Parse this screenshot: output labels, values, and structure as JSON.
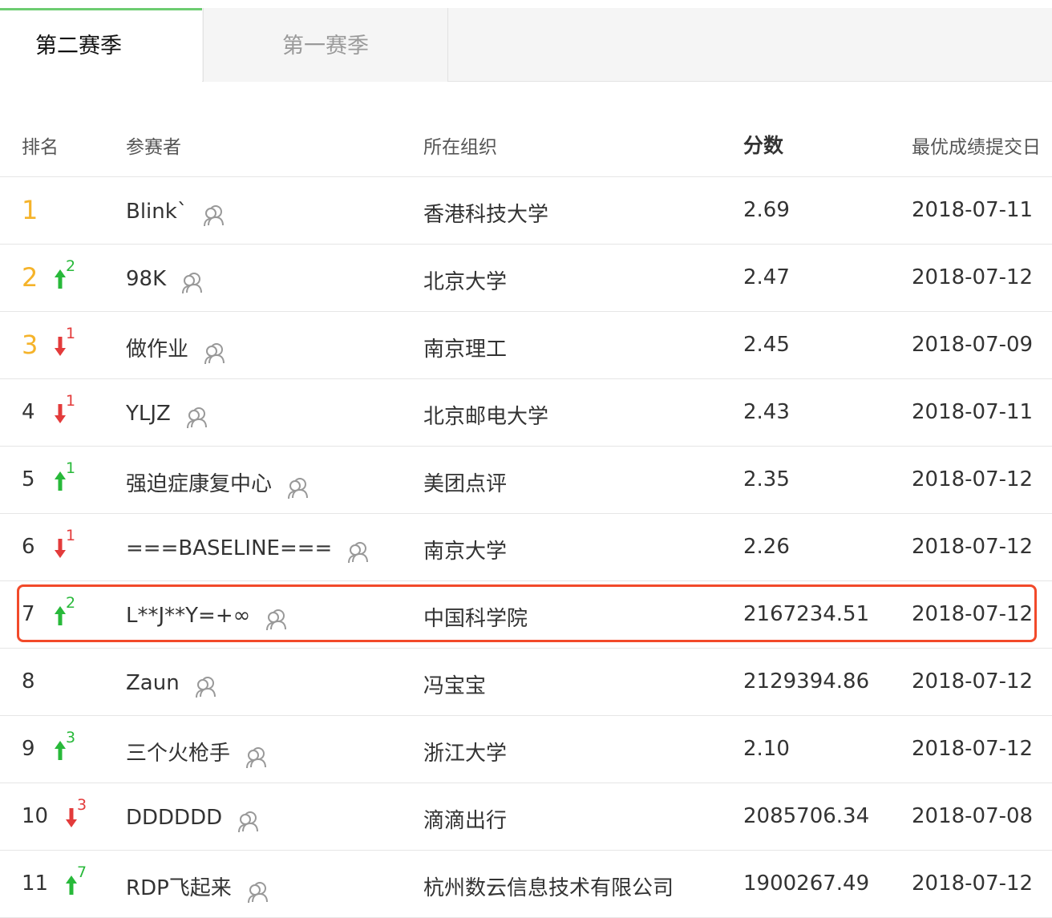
{
  "tabs": [
    {
      "label": "第二赛季",
      "active": true
    },
    {
      "label": "第一赛季",
      "active": false
    }
  ],
  "columns": [
    "排名",
    "参赛者",
    "所在组织",
    "分数",
    "最优成绩提交日"
  ],
  "colors": {
    "accent": "#6ccc70",
    "top_rank": "#f5b32a",
    "up": "#28b93a",
    "down": "#e33b3b",
    "highlight": "#f24a2a"
  },
  "icons": {
    "up": "arrow-up-icon",
    "down": "arrow-down-icon",
    "team": "team-icon"
  },
  "rows": [
    {
      "rank": "1",
      "trend": "",
      "change": "",
      "name": "Blink`",
      "org": "香港科技大学",
      "score": "2.69",
      "date": "2018-07-11"
    },
    {
      "rank": "2",
      "trend": "up",
      "change": "2",
      "name": "98K",
      "org": "北京大学",
      "score": "2.47",
      "date": "2018-07-12"
    },
    {
      "rank": "3",
      "trend": "down",
      "change": "1",
      "name": "做作业",
      "org": "南京理工",
      "score": "2.45",
      "date": "2018-07-09"
    },
    {
      "rank": "4",
      "trend": "down",
      "change": "1",
      "name": "YLJZ",
      "org": "北京邮电大学",
      "score": "2.43",
      "date": "2018-07-11"
    },
    {
      "rank": "5",
      "trend": "up",
      "change": "1",
      "name": "强迫症康复中心",
      "org": "美团点评",
      "score": "2.35",
      "date": "2018-07-12"
    },
    {
      "rank": "6",
      "trend": "down",
      "change": "1",
      "name": "===BASELINE===",
      "org": "南京大学",
      "score": "2.26",
      "date": "2018-07-12"
    },
    {
      "rank": "7",
      "trend": "up",
      "change": "2",
      "name": "L**J**Y=+∞",
      "org": "中国科学院",
      "score": "2167234.51",
      "date": "2018-07-12",
      "highlighted": true
    },
    {
      "rank": "8",
      "trend": "",
      "change": "",
      "name": "Zaun",
      "org": "冯宝宝",
      "score": "2129394.86",
      "date": "2018-07-12"
    },
    {
      "rank": "9",
      "trend": "up",
      "change": "3",
      "name": "三个火枪手",
      "org": "浙江大学",
      "score": "2.10",
      "date": "2018-07-12"
    },
    {
      "rank": "10",
      "trend": "down",
      "change": "3",
      "name": "DDDDDD",
      "org": "滴滴出行",
      "score": "2085706.34",
      "date": "2018-07-08"
    },
    {
      "rank": "11",
      "trend": "up",
      "change": "7",
      "name": "RDP飞起来",
      "org": "杭州数云信息技术有限公司",
      "score": "1900267.49",
      "date": "2018-07-12"
    }
  ]
}
